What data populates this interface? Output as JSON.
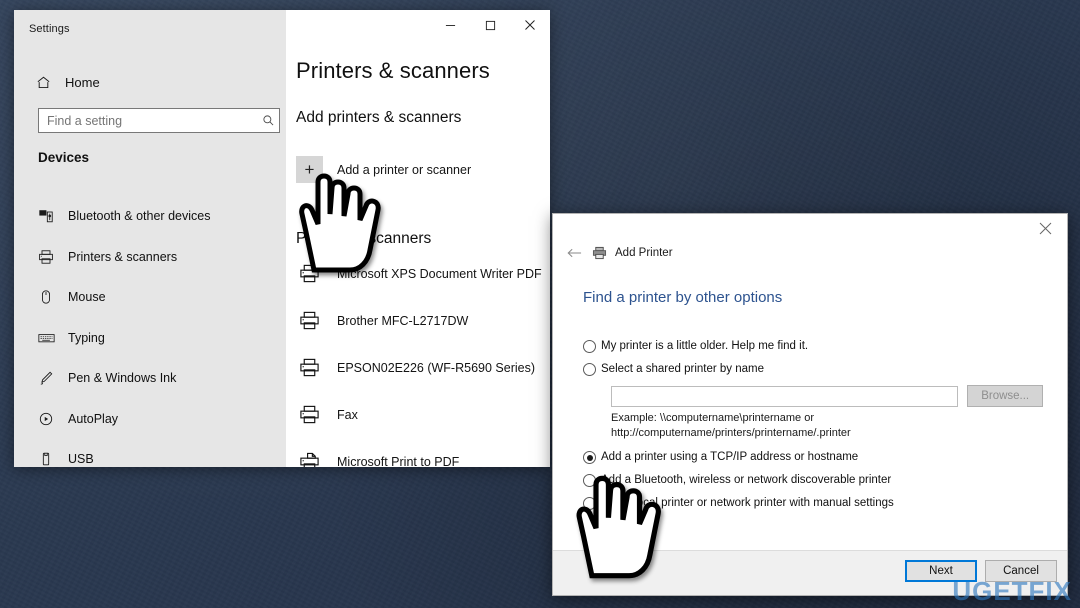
{
  "desktop": {
    "background_color": "#2b3a50"
  },
  "settings_window": {
    "title": "Settings",
    "window_controls": {
      "minimize": "minimize-button",
      "maximize": "maximize-button",
      "close": "close-button"
    },
    "sidebar": {
      "home_label": "Home",
      "home_icon": "home-icon",
      "search": {
        "placeholder": "Find a setting",
        "value": "",
        "icon": "search-icon"
      },
      "group_label": "Devices",
      "items": [
        {
          "label": "Bluetooth & other devices",
          "icon": "bluetooth-devices-icon"
        },
        {
          "label": "Printers & scanners",
          "icon": "printer-icon"
        },
        {
          "label": "Mouse",
          "icon": "mouse-icon"
        },
        {
          "label": "Typing",
          "icon": "keyboard-icon"
        },
        {
          "label": "Pen & Windows Ink",
          "icon": "pen-icon"
        },
        {
          "label": "AutoPlay",
          "icon": "autoplay-icon"
        },
        {
          "label": "USB",
          "icon": "usb-icon"
        }
      ]
    },
    "main": {
      "page_title": "Printers & scanners",
      "add_section_title": "Add printers & scanners",
      "add_button_label": "Add a printer or scanner",
      "add_button_icon": "plus-icon",
      "printers_section_title": "Printers & scanners",
      "printers": [
        {
          "label": "Microsoft XPS Document Writer PDF",
          "icon": "printer-icon"
        },
        {
          "label": "Brother MFC-L2717DW",
          "icon": "printer-icon"
        },
        {
          "label": "EPSON02E226 (WF-R5690 Series)",
          "icon": "printer-icon"
        },
        {
          "label": "Fax",
          "icon": "printer-icon"
        },
        {
          "label": "Microsoft Print to PDF",
          "icon": "print-to-pdf-icon"
        }
      ]
    }
  },
  "add_printer_dialog": {
    "title": "Add Printer",
    "title_icon": "printer-icon",
    "back_icon": "back-arrow-icon",
    "close_icon": "close-icon",
    "heading": "Find a printer by other options",
    "heading_color": "#2d538f",
    "options": [
      {
        "label": "My printer is a little older. Help me find it.",
        "checked": false
      },
      {
        "label": "Select a shared printer by name",
        "checked": false
      },
      {
        "label": "Add a printer using a TCP/IP address or hostname",
        "checked": true
      },
      {
        "label": "Add a Bluetooth, wireless or network discoverable printer",
        "checked": false
      },
      {
        "label": "Add a local printer or network printer with manual settings",
        "checked": false
      }
    ],
    "shared_printer_input": {
      "value": "",
      "placeholder": ""
    },
    "browse_button_label": "Browse...",
    "example_line1": "Example: \\\\computername\\printername or",
    "example_line2": "http://computername/printers/printername/.printer",
    "buttons": {
      "next": "Next",
      "cancel": "Cancel"
    }
  },
  "cursors": [
    {
      "name": "hand-cursor-settings"
    },
    {
      "name": "hand-cursor-dialog"
    }
  ],
  "watermark": {
    "text": "UGETFIX",
    "color": "#2d78be"
  }
}
